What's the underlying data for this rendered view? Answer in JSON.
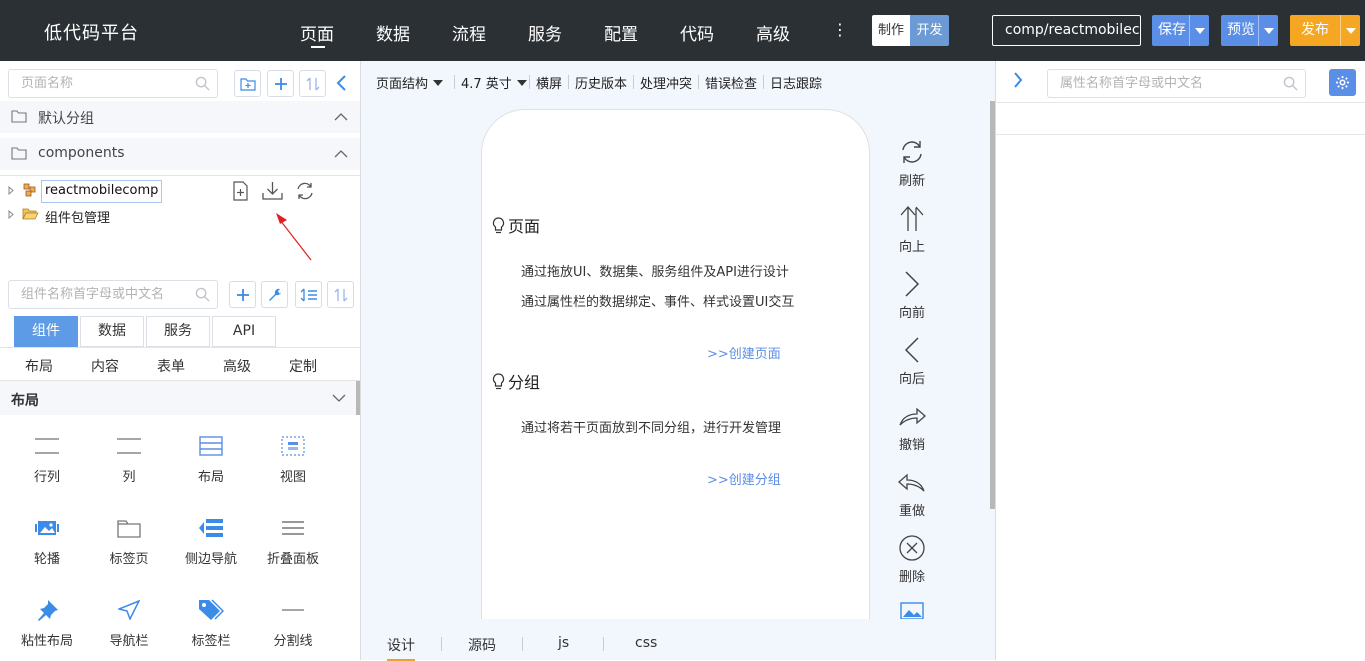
{
  "app": {
    "title": "低代码平台"
  },
  "nav": {
    "items": [
      "页面",
      "数据",
      "流程",
      "服务",
      "配置",
      "代码",
      "高级"
    ],
    "more": "⋮"
  },
  "mode": {
    "make": "制作",
    "dev": "开发"
  },
  "project": {
    "name": "comp/reactmobilec"
  },
  "actions": {
    "save": "保存",
    "preview": "预览",
    "publish": "发布"
  },
  "left": {
    "page_search": {
      "placeholder": "页面名称"
    },
    "groups": [
      {
        "name": "默认分组"
      },
      {
        "name": "components"
      }
    ],
    "tree": [
      {
        "label": "reactmobilecomp"
      },
      {
        "label": "组件包管理"
      }
    ],
    "comp_search": {
      "placeholder": "组件名称首字母或中文名"
    },
    "tabs": [
      "组件",
      "数据",
      "服务",
      "API"
    ],
    "subtabs": [
      "布局",
      "内容",
      "表单",
      "高级",
      "定制"
    ],
    "category": "布局",
    "widgets": [
      {
        "label": "行列",
        "icon": "row-col-icon"
      },
      {
        "label": "列",
        "icon": "column-icon"
      },
      {
        "label": "布局",
        "icon": "layout-icon"
      },
      {
        "label": "视图",
        "icon": "view-icon"
      },
      {
        "label": "轮播",
        "icon": "carousel-icon"
      },
      {
        "label": "标签页",
        "icon": "tabs-icon"
      },
      {
        "label": "侧边导航",
        "icon": "side-nav-icon"
      },
      {
        "label": "折叠面板",
        "icon": "collapse-icon"
      },
      {
        "label": "粘性布局",
        "icon": "pin-icon"
      },
      {
        "label": "导航栏",
        "icon": "navbar-icon"
      },
      {
        "label": "标签栏",
        "icon": "tag-icon"
      },
      {
        "label": "分割线",
        "icon": "divider-icon"
      }
    ]
  },
  "center": {
    "toolbar": {
      "structure": "页面结构",
      "device": "4.7 英寸",
      "landscape": "横屏",
      "history": "历史版本",
      "conflict": "处理冲突",
      "errors": "错误检查",
      "logs": "日志跟踪"
    },
    "phone": {
      "page_title": "页面",
      "page_desc1": "通过拖放UI、数据集、服务组件及API进行设计",
      "page_desc2": "通过属性栏的数据绑定、事件、样式设置UI交互",
      "page_link": ">>创建页面",
      "group_title": "分组",
      "group_desc": "通过将若干页面放到不同分组，进行开发管理",
      "group_link": ">>创建分组"
    },
    "side_tools": [
      "刷新",
      "向上",
      "向前",
      "向后",
      "撤销",
      "重做",
      "删除"
    ],
    "bottom_tabs": [
      "设计",
      "源码",
      "js",
      "css"
    ]
  },
  "right": {
    "search": {
      "placeholder": "属性名称首字母或中文名"
    }
  },
  "colors": {
    "topbar": "#2b3034",
    "accent": "#5b8ee6",
    "publish": "#f5a623",
    "canvas_bg": "#f2f6fd"
  }
}
